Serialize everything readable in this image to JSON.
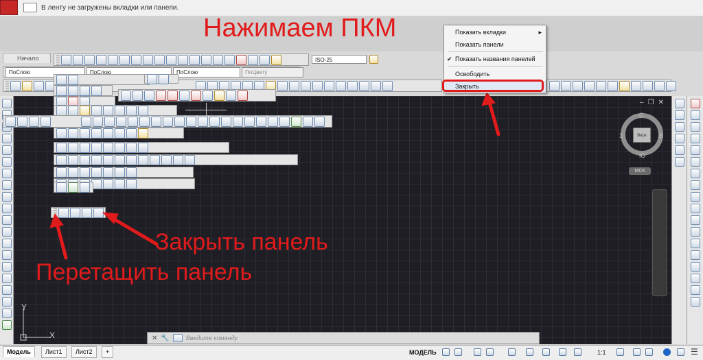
{
  "ribbon": {
    "message": "В ленту не загружены вкладки или панели.",
    "tab_home": "Начало"
  },
  "properties_bar": {
    "layer_value": "ПоСлою",
    "linetype_value": "ПоСлою",
    "lineweight_value": "ПоСлою",
    "plotstyle_value": "ПоЦвету",
    "dimstyle_value": "ISO-25"
  },
  "annotations": {
    "title": "Нажимаем ПКМ",
    "close_panel": "Закрыть панель",
    "drag_panel": "Перетащить панель",
    "color": "#e11b1b"
  },
  "context_menu": {
    "items": [
      {
        "label": "Показать вкладки",
        "submenu": true
      },
      {
        "label": "Показать панели"
      },
      {
        "label": "Показать названия панелей",
        "checked": true
      },
      {
        "label": "Освободить"
      },
      {
        "label": "Закрыть",
        "highlighted": true
      }
    ]
  },
  "viewcube": {
    "top": "Верх",
    "north": "С",
    "south": "Ю",
    "west": "З",
    "east": "В",
    "ucs": "МСК"
  },
  "command_line": {
    "placeholder": "Введите команду"
  },
  "layout_tabs": [
    "Модель",
    "Лист1",
    "Лист2"
  ],
  "add_tab": "+",
  "status": {
    "model": "МОДЕЛЬ",
    "scale": "1:1"
  },
  "ucs_icon": {
    "x": "X",
    "y": "Y"
  }
}
